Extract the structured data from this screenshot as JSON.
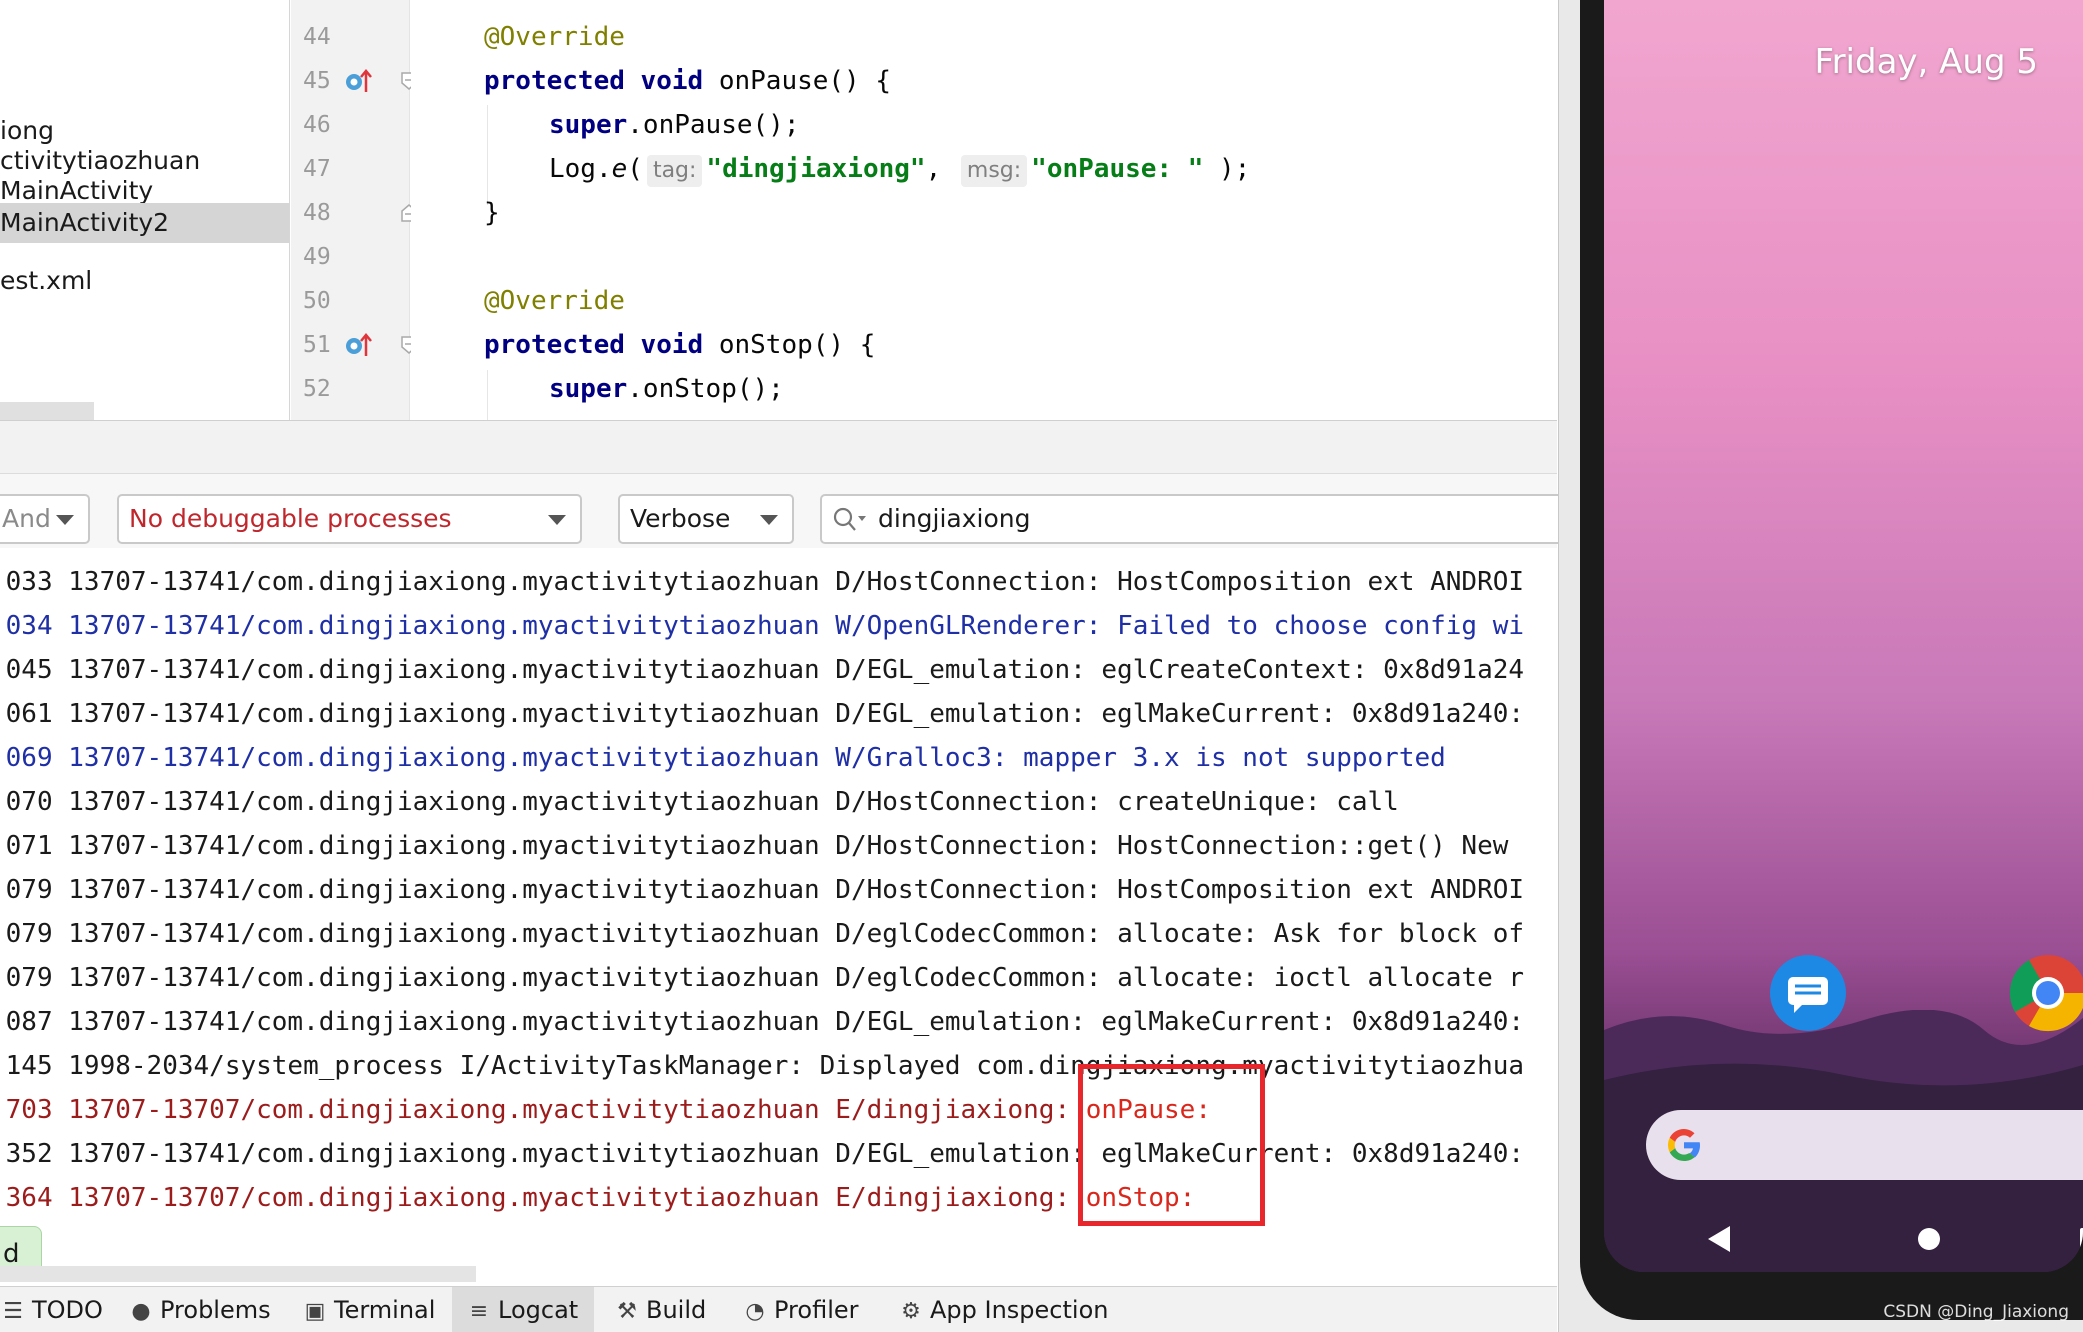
{
  "project_tree": {
    "items": [
      {
        "label": "iong",
        "selected": false
      },
      {
        "label": "ctivitytiaozhuan",
        "selected": false
      },
      {
        "label": "MainActivity",
        "selected": false
      },
      {
        "label": "MainActivity2",
        "selected": true
      },
      {
        "label": "est.xml",
        "selected": false
      }
    ]
  },
  "editor": {
    "line_numbers": [
      "44",
      "45",
      "46",
      "47",
      "48",
      "49",
      "50",
      "51",
      "52"
    ],
    "lines": {
      "l44": {
        "annotation": "@Override"
      },
      "l45": {
        "kw1": "protected",
        "kw2": "void",
        "rest": " onPause() {"
      },
      "l46": {
        "kw": "super",
        "rest": ".onPause();"
      },
      "l47": {
        "prefix": "Log.",
        "method": "e",
        "open": "(",
        "hint_tag": "tag:",
        "str_tag": "\"dingjiaxiong\"",
        "comma": ", ",
        "hint_msg": "msg:",
        "str_msg": "\"onPause: \"",
        "close": " );"
      },
      "l48": {
        "text": "}"
      },
      "l50": {
        "annotation": "@Override"
      },
      "l51": {
        "kw1": "protected",
        "kw2": "void",
        "rest": " onStop() {"
      },
      "l52": {
        "kw": "super",
        "rest": ".onStop();"
      }
    },
    "gutter_icons": [
      "override-up-icon",
      "override-up-icon"
    ]
  },
  "logcat": {
    "device_filter": "And",
    "process_filter": "No debuggable processes",
    "process_filter_color": "#c0272d",
    "level_filter": "Verbose",
    "search_value": "dingjiaxiong",
    "colors": {
      "debug": "#1a1a1a",
      "warn": "#1f2fa5",
      "error": "#9c1c1c",
      "error_msg": "#d9271c"
    },
    "lines": [
      {
        "time": ".033",
        "pid": "13707-13741/com.dingjiaxiong.myactivitytiaozhuan",
        "tag": "D/HostConnection:",
        "msg": "HostComposition ext ANDROI",
        "level": "debug"
      },
      {
        "time": ".034",
        "pid": "13707-13741/com.dingjiaxiong.myactivitytiaozhuan",
        "tag": "W/OpenGLRenderer:",
        "msg": "Failed to choose config wi",
        "level": "warn"
      },
      {
        "time": ".045",
        "pid": "13707-13741/com.dingjiaxiong.myactivitytiaozhuan",
        "tag": "D/EGL_emulation:",
        "msg": "eglCreateContext: 0x8d91a24",
        "level": "debug"
      },
      {
        "time": ".061",
        "pid": "13707-13741/com.dingjiaxiong.myactivitytiaozhuan",
        "tag": "D/EGL_emulation:",
        "msg": "eglMakeCurrent: 0x8d91a240:",
        "level": "debug"
      },
      {
        "time": ".069",
        "pid": "13707-13741/com.dingjiaxiong.myactivitytiaozhuan",
        "tag": "W/Gralloc3:",
        "msg": "mapper 3.x is not supported",
        "level": "warn"
      },
      {
        "time": ".070",
        "pid": "13707-13741/com.dingjiaxiong.myactivitytiaozhuan",
        "tag": "D/HostConnection:",
        "msg": "createUnique: call",
        "level": "debug"
      },
      {
        "time": ".071",
        "pid": "13707-13741/com.dingjiaxiong.myactivitytiaozhuan",
        "tag": "D/HostConnection:",
        "msg": "HostConnection::get() New",
        "level": "debug"
      },
      {
        "time": ".079",
        "pid": "13707-13741/com.dingjiaxiong.myactivitytiaozhuan",
        "tag": "D/HostConnection:",
        "msg": "HostComposition ext ANDROI",
        "level": "debug"
      },
      {
        "time": ".079",
        "pid": "13707-13741/com.dingjiaxiong.myactivitytiaozhuan",
        "tag": "D/eglCodecCommon:",
        "msg": "allocate: Ask for block of",
        "level": "debug"
      },
      {
        "time": ".079",
        "pid": "13707-13741/com.dingjiaxiong.myactivitytiaozhuan",
        "tag": "D/eglCodecCommon:",
        "msg": "allocate: ioctl allocate r",
        "level": "debug"
      },
      {
        "time": ".087",
        "pid": "13707-13741/com.dingjiaxiong.myactivitytiaozhuan",
        "tag": "D/EGL_emulation:",
        "msg": "eglMakeCurrent: 0x8d91a240:",
        "level": "debug"
      },
      {
        "time": ".145",
        "pid": "1998-2034/system_process",
        "tag": "I/ActivityTaskManager:",
        "msg": "Displayed com.dingjiaxiong.myactivitytiaozhua",
        "level": "debug"
      },
      {
        "time": ".703",
        "pid": "13707-13707/com.dingjiaxiong.myactivitytiaozhuan",
        "tag": "E/dingjiaxiong:",
        "msg": "onPause:",
        "level": "error"
      },
      {
        "time": ".352",
        "pid": "13707-13741/com.dingjiaxiong.myactivitytiaozhuan",
        "tag": "D/EGL_emulation:",
        "msg": "eglMakeCurrent: 0x8d91a240:",
        "level": "debug"
      },
      {
        "time": ".364",
        "pid": "13707-13707/com.dingjiaxiong.myactivitytiaozhuan",
        "tag": "E/dingjiaxiong:",
        "msg": "onStop:",
        "level": "error"
      }
    ],
    "toast_text": "d"
  },
  "bottom_tabs": [
    {
      "label": "TODO",
      "icon": "list-icon",
      "active": false
    },
    {
      "label": "Problems",
      "icon": "info-icon",
      "active": false
    },
    {
      "label": "Terminal",
      "icon": "terminal-icon",
      "active": false
    },
    {
      "label": "Logcat",
      "icon": "logcat-icon",
      "active": true
    },
    {
      "label": "Build",
      "icon": "hammer-icon",
      "active": false
    },
    {
      "label": "Profiler",
      "icon": "gauge-icon",
      "active": false
    },
    {
      "label": "App Inspection",
      "icon": "inspection-icon",
      "active": false
    }
  ],
  "emulator": {
    "date": "Friday, Aug 5",
    "watermark": "CSDN @Ding_Jiaxiong",
    "apps": [
      "messages-icon",
      "chrome-icon"
    ],
    "nav": [
      "back-icon",
      "home-icon",
      "recents-icon"
    ]
  }
}
